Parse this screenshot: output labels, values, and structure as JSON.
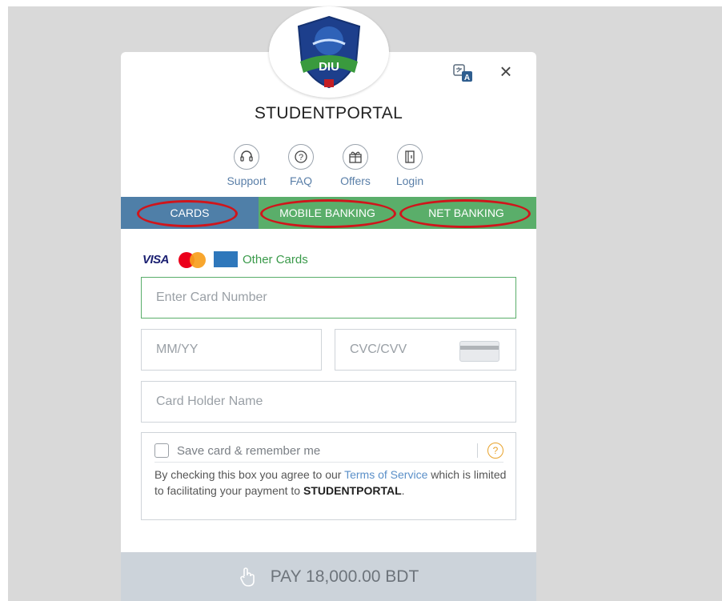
{
  "merchant": {
    "name": "STUDENTPORTAL",
    "logo_text": "DIU"
  },
  "quick_links": [
    {
      "label": "Support",
      "icon": "headset-icon"
    },
    {
      "label": "FAQ",
      "icon": "question-icon"
    },
    {
      "label": "Offers",
      "icon": "gift-icon"
    },
    {
      "label": "Login",
      "icon": "login-door-icon"
    }
  ],
  "tabs": [
    {
      "label": "CARDS",
      "active": true
    },
    {
      "label": "MOBILE BANKING"
    },
    {
      "label": "NET BANKING"
    }
  ],
  "card_brands": {
    "visa": "VISA",
    "amex": "AMERICAN EXPRESS",
    "other": "Other Cards"
  },
  "form": {
    "card_number_placeholder": "Enter Card Number",
    "expiry_placeholder": "MM/YY",
    "cvc_placeholder": "CVC/CVV",
    "holder_placeholder": "Card Holder Name"
  },
  "save_card": {
    "label": "Save card & remember me",
    "help": "?",
    "terms_prefix": "By checking this box you agree to our ",
    "terms_link": "Terms of Service",
    "terms_middle": " which is limited to facilitating your payment to ",
    "terms_merchant": "STUDENTPORTAL",
    "terms_suffix": "."
  },
  "pay_button": {
    "label": "PAY 18,000.00 BDT"
  },
  "colors": {
    "cards_tab": "#4f7fa8",
    "banking_tabs": "#5aae6a",
    "highlight_ring": "#d0151b",
    "pay_bar": "#ccd3da"
  },
  "close_glyph": "×"
}
